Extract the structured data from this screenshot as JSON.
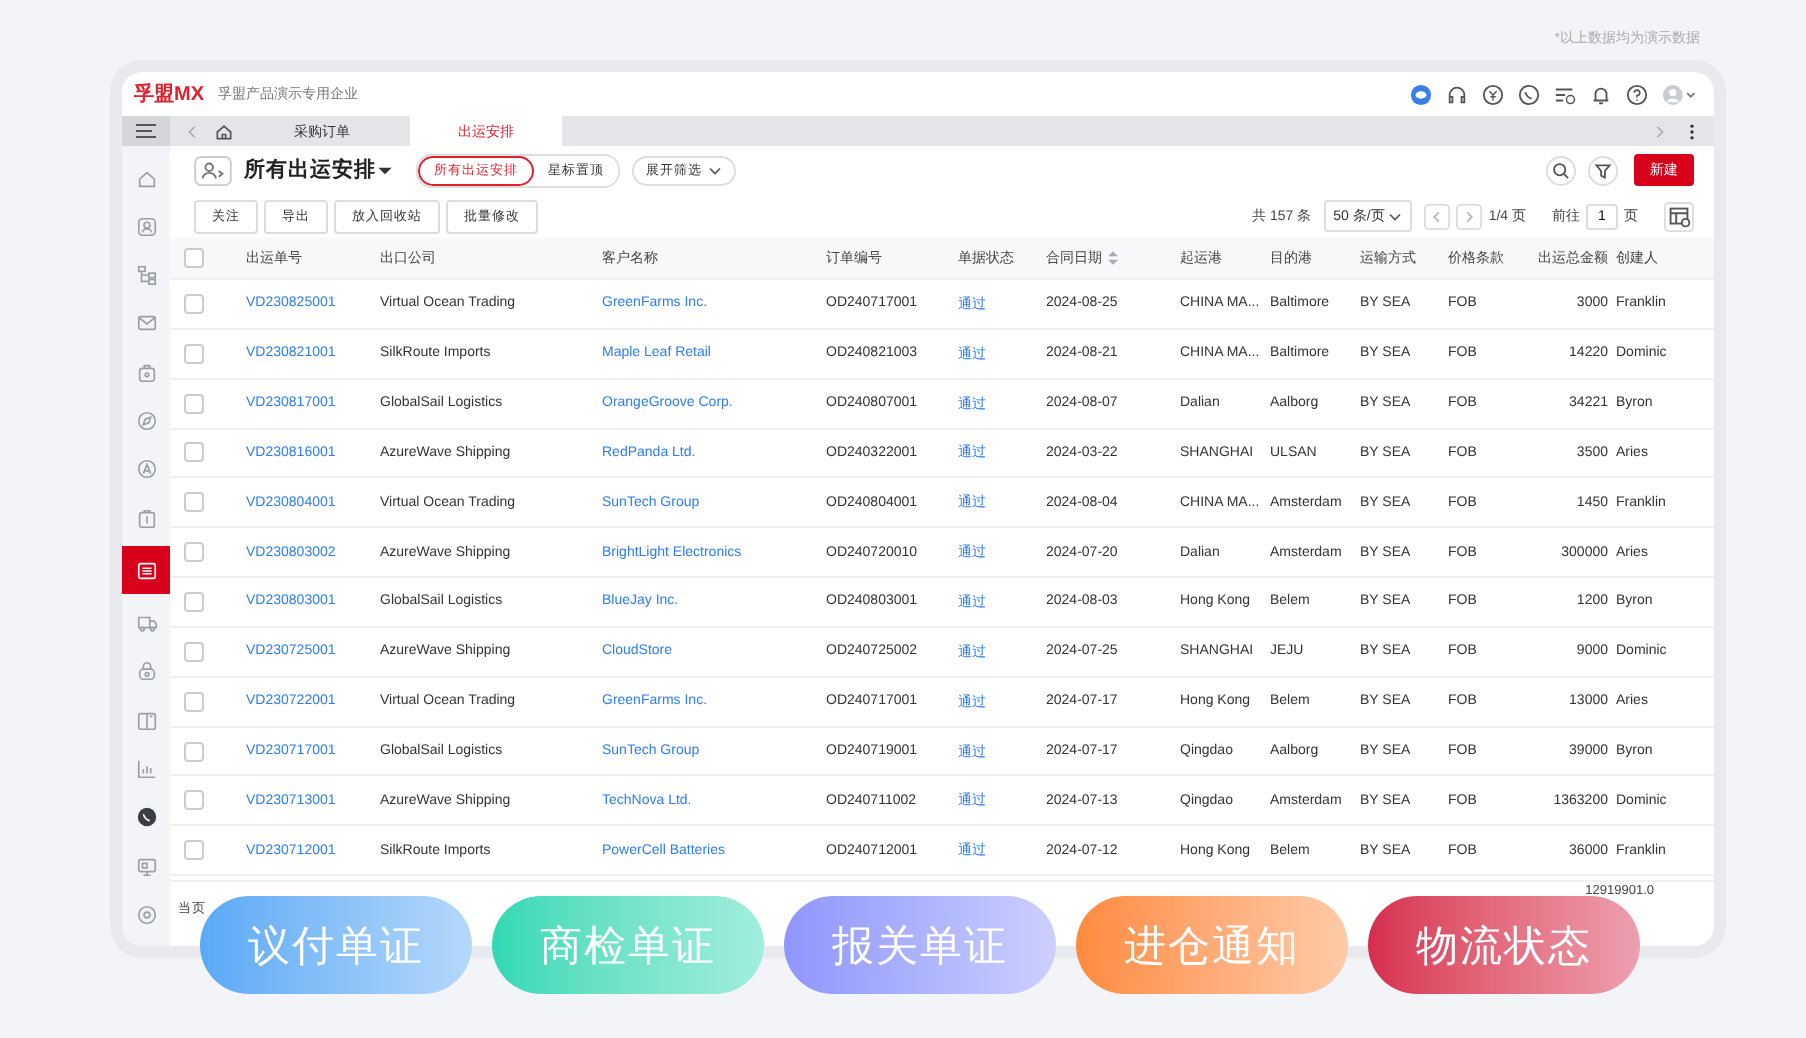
{
  "disclaimer": "*以上数据均为演示数据",
  "header": {
    "logo": "孚盟MX",
    "company": "孚盟产品演示专用企业"
  },
  "tabs": [
    {
      "label": "采购订单",
      "selected": false
    },
    {
      "label": "出运安排",
      "selected": true
    }
  ],
  "sidebar": {
    "items": [
      {
        "selected": false
      },
      {
        "selected": false
      },
      {
        "selected": false
      },
      {
        "selected": false
      },
      {
        "selected": false
      },
      {
        "selected": false
      },
      {
        "selected": false
      },
      {
        "selected": false
      },
      {
        "selected": true
      },
      {
        "selected": false
      },
      {
        "selected": false
      },
      {
        "selected": false
      },
      {
        "selected": false
      },
      {
        "selected": false
      },
      {
        "selected": false
      },
      {
        "selected": false
      }
    ]
  },
  "view": {
    "title": "所有出运安排",
    "filters": [
      {
        "label": "所有出运安排",
        "selected": true
      },
      {
        "label": "星标置顶",
        "selected": false
      }
    ],
    "expand": "展开筛选",
    "new_button": "新建"
  },
  "actions": [
    "关注",
    "导出",
    "放入回收站",
    "批量修改"
  ],
  "pagination": {
    "total": "共 157 条",
    "page_size": "50 条/页",
    "page": "1/4 页",
    "goto_label": "前往",
    "goto_value": "1",
    "goto_unit": "页"
  },
  "table": {
    "header_checked": false,
    "columns": [
      {
        "label": "出运单号",
        "sortable": false
      },
      {
        "label": "出口公司",
        "sortable": false
      },
      {
        "label": "客户名称",
        "sortable": false
      },
      {
        "label": "订单编号",
        "sortable": false
      },
      {
        "label": "单据状态",
        "sortable": false
      },
      {
        "label": "合同日期",
        "sortable": true
      },
      {
        "label": "起运港",
        "sortable": false
      },
      {
        "label": "目的港",
        "sortable": false
      },
      {
        "label": "运输方式",
        "sortable": false
      },
      {
        "label": "价格条款",
        "sortable": false
      },
      {
        "label": "出运总金额",
        "sortable": false
      },
      {
        "label": "创建人",
        "sortable": false
      }
    ],
    "rows": [
      {
        "checked": false,
        "cells": [
          "VD230825001",
          "Virtual Ocean Trading",
          "GreenFarms Inc.",
          "OD240717001",
          "通过",
          "2024-08-25",
          "CHINA MA...",
          "Baltimore",
          "BY SEA",
          "FOB",
          "3000",
          "Franklin"
        ]
      },
      {
        "checked": false,
        "cells": [
          "VD230821001",
          "SilkRoute Imports",
          "Maple Leaf Retail",
          "OD240821003",
          "通过",
          "2024-08-21",
          "CHINA MA...",
          "Baltimore",
          "BY SEA",
          "FOB",
          "14220",
          "Dominic"
        ]
      },
      {
        "checked": false,
        "cells": [
          "VD230817001",
          "GlobalSail Logistics",
          "OrangeGroove Corp.",
          "OD240807001",
          "通过",
          "2024-08-07",
          "Dalian",
          "Aalborg",
          "BY SEA",
          "FOB",
          "34221",
          "Byron"
        ]
      },
      {
        "checked": false,
        "cells": [
          "VD230816001",
          "AzureWave Shipping",
          "RedPanda Ltd.",
          "OD240322001",
          "通过",
          "2024-03-22",
          "SHANGHAI",
          "ULSAN",
          "BY SEA",
          "FOB",
          "3500",
          "Aries"
        ]
      },
      {
        "checked": false,
        "cells": [
          "VD230804001",
          "Virtual Ocean Trading",
          "SunTech Group",
          "OD240804001",
          "通过",
          "2024-08-04",
          "CHINA MA...",
          "Amsterdam",
          "BY SEA",
          "FOB",
          "1450",
          "Franklin"
        ]
      },
      {
        "checked": false,
        "cells": [
          "VD230803002",
          "AzureWave Shipping",
          "BrightLight Electronics",
          "OD240720010",
          "通过",
          "2024-07-20",
          "Dalian",
          "Amsterdam",
          "BY SEA",
          "FOB",
          "300000",
          "Aries"
        ]
      },
      {
        "checked": false,
        "cells": [
          "VD230803001",
          "GlobalSail Logistics",
          "BlueJay Inc.",
          "OD240803001",
          "通过",
          "2024-08-03",
          "Hong Kong",
          "Belem",
          "BY SEA",
          "FOB",
          "1200",
          "Byron"
        ]
      },
      {
        "checked": false,
        "cells": [
          "VD230725001",
          "AzureWave Shipping",
          "CloudStore",
          "OD240725002",
          "通过",
          "2024-07-25",
          "SHANGHAI",
          "JEJU",
          "BY SEA",
          "FOB",
          "9000",
          "Dominic"
        ]
      },
      {
        "checked": false,
        "cells": [
          "VD230722001",
          "Virtual Ocean Trading",
          "GreenFarms Inc.",
          "OD240717001",
          "通过",
          "2024-07-17",
          "Hong Kong",
          "Belem",
          "BY SEA",
          "FOB",
          "13000",
          "Aries"
        ]
      },
      {
        "checked": false,
        "cells": [
          "VD230717001",
          "GlobalSail Logistics",
          "SunTech Group",
          "OD240719001",
          "通过",
          "2024-07-17",
          "Qingdao",
          "Aalborg",
          "BY SEA",
          "FOB",
          "39000",
          "Byron"
        ]
      },
      {
        "checked": false,
        "cells": [
          "VD230713001",
          "AzureWave Shipping",
          "TechNova Ltd.",
          "OD240711002",
          "通过",
          "2024-07-13",
          "Qingdao",
          "Amsterdam",
          "BY SEA",
          "FOB",
          "1363200",
          "Dominic"
        ]
      },
      {
        "checked": false,
        "cells": [
          "VD230712001",
          "SilkRoute Imports",
          "PowerCell Batteries",
          "OD240712001",
          "通过",
          "2024-07-12",
          "Hong Kong",
          "Belem",
          "BY SEA",
          "FOB",
          "36000",
          "Franklin"
        ]
      }
    ],
    "footer_label": "当页",
    "footer_total": "12919901.0"
  },
  "badges": [
    {
      "label": "议付单证",
      "color": "#5aa9f5"
    },
    {
      "label": "商检单证",
      "color": "#2fd9b5"
    },
    {
      "label": "报关单证",
      "color": "#8f96fc"
    },
    {
      "label": "进仓通知",
      "color": "#ff8a3d"
    },
    {
      "label": "物流状态",
      "color": "#d62c50"
    }
  ]
}
